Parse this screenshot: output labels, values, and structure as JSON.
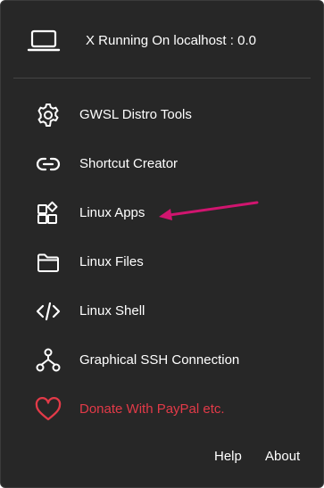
{
  "header": {
    "icon": "laptop-icon",
    "status_text": "X Running On localhost : 0.0"
  },
  "menu": {
    "items": [
      {
        "id": "distro-tools",
        "icon": "gear-icon",
        "label": "GWSL Distro Tools"
      },
      {
        "id": "shortcut-creator",
        "icon": "link-icon",
        "label": "Shortcut Creator"
      },
      {
        "id": "linux-apps",
        "icon": "apps-grid-icon",
        "label": "Linux Apps"
      },
      {
        "id": "linux-files",
        "icon": "folder-icon",
        "label": "Linux Files"
      },
      {
        "id": "linux-shell",
        "icon": "code-icon",
        "label": "Linux Shell"
      },
      {
        "id": "graphical-ssh",
        "icon": "network-icon",
        "label": "Graphical SSH Connection"
      },
      {
        "id": "donate",
        "icon": "heart-icon",
        "label": "Donate With PayPal etc."
      }
    ]
  },
  "footer": {
    "help_label": "Help",
    "about_label": "About"
  },
  "annotation": {
    "arrow_color": "#d0156f",
    "points_to": "linux-apps"
  },
  "colors": {
    "background": "#272727",
    "text": "#ffffff",
    "donate": "#e23a48",
    "divider": "#444444"
  }
}
